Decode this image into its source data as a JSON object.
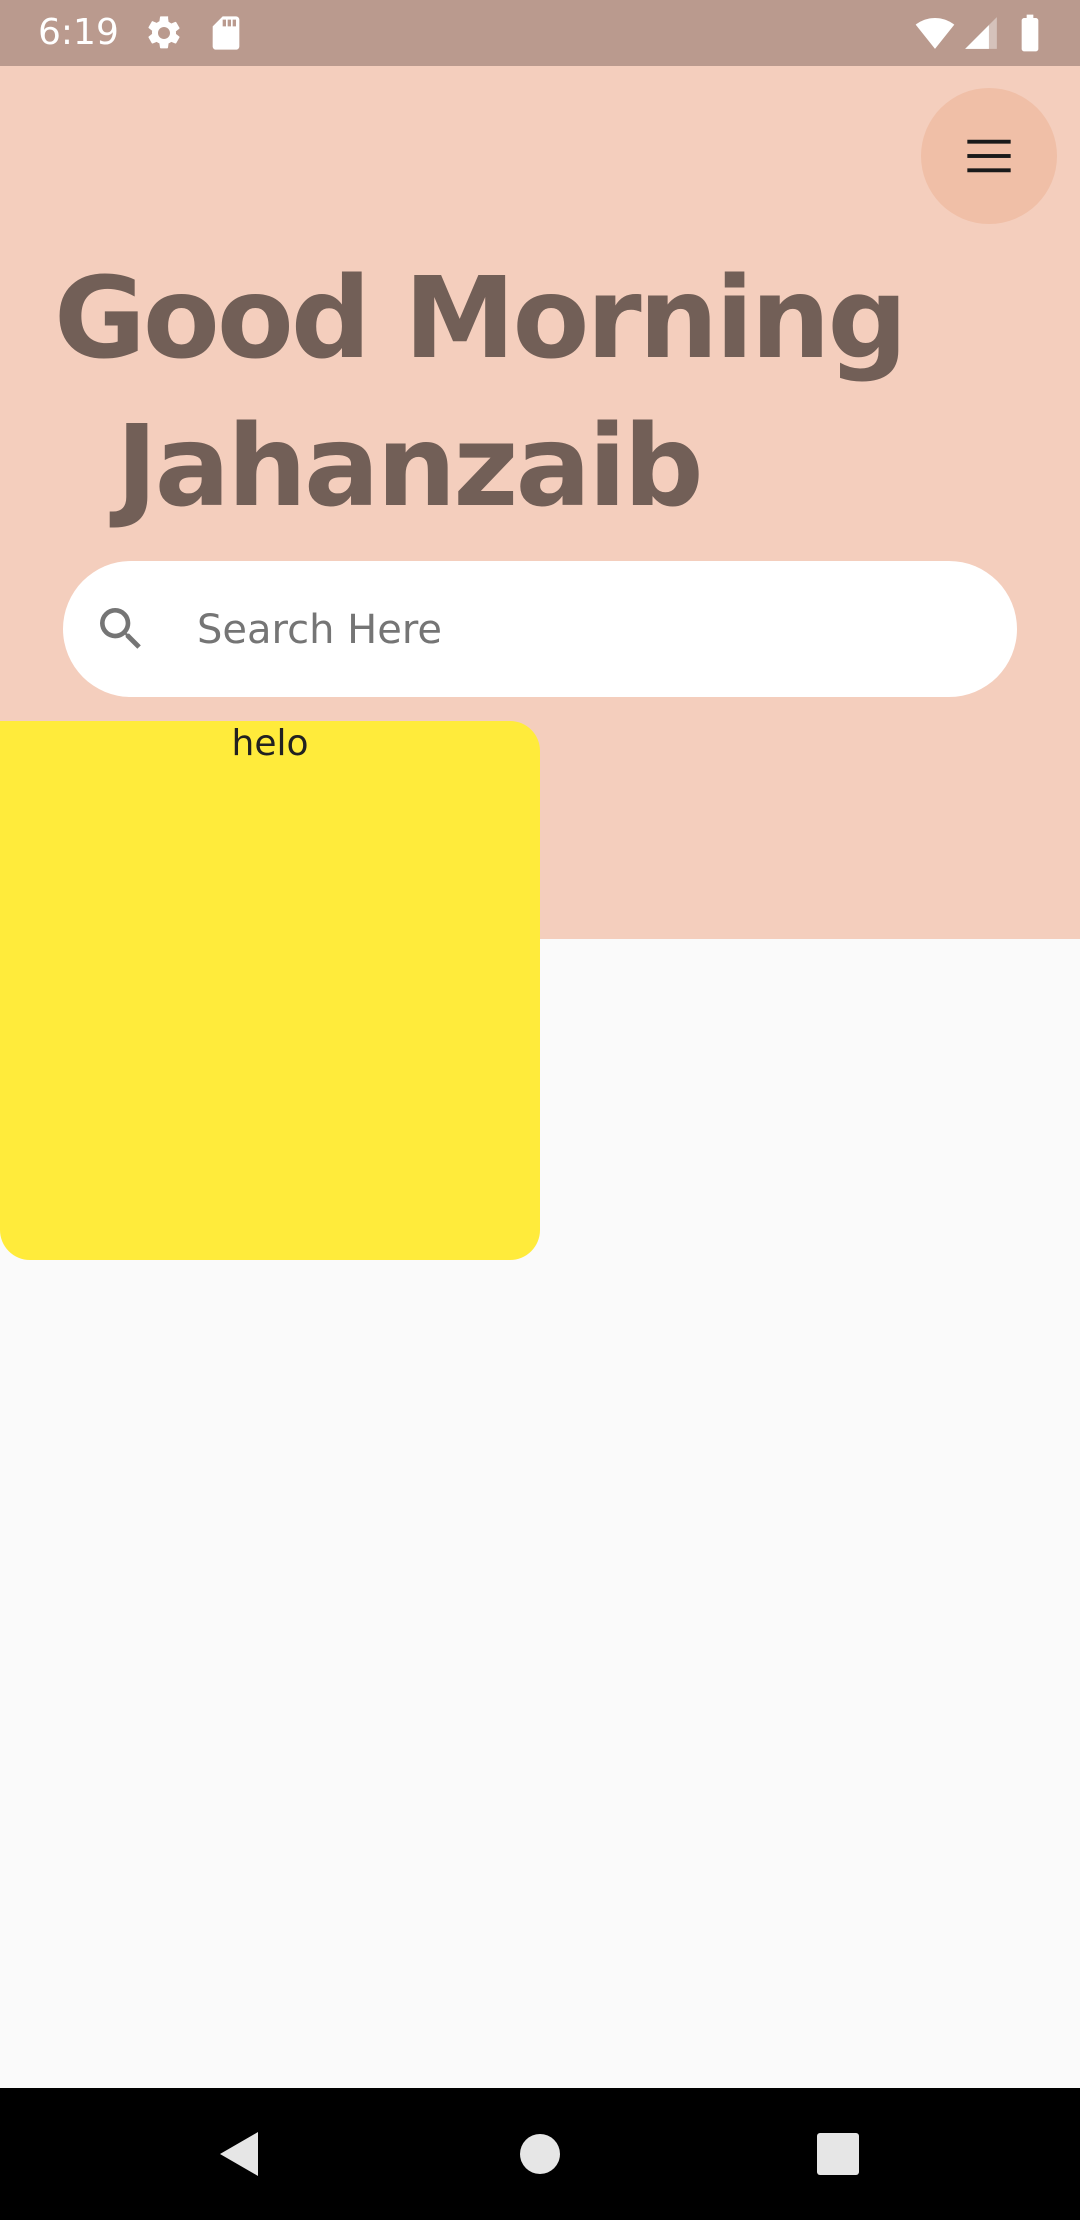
{
  "status_bar": {
    "time": "6:19",
    "left_icons": [
      "gear-icon",
      "sd-card-icon"
    ],
    "right_icons": [
      "wifi-icon",
      "cell-signal-icon",
      "battery-icon"
    ],
    "background_color": "#BA9A8E"
  },
  "header": {
    "background_color": "#F4CEBD",
    "menu_icon": "menu-icon",
    "greeting_line1": "Good Morning",
    "greeting_line2": "Jahanzaib",
    "text_color": "#725F57"
  },
  "search": {
    "icon": "search-icon",
    "placeholder": "Search Here",
    "value": ""
  },
  "card": {
    "label": "helo",
    "color": "#FFEB3B"
  },
  "nav_bar": {
    "buttons": [
      "back-icon",
      "home-icon",
      "recents-icon"
    ]
  }
}
